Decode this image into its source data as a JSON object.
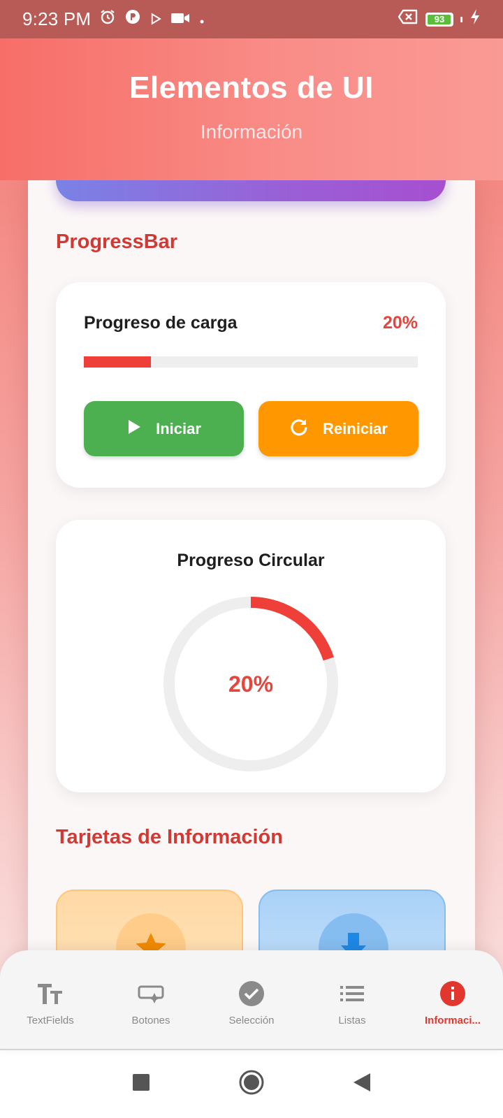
{
  "status_bar": {
    "time": "9:23 PM",
    "battery": "93",
    "icons_left": [
      "alarm-icon",
      "app-icon",
      "play-store-icon",
      "video-icon",
      "dot-icon"
    ],
    "icons_right": [
      "no-sim-icon",
      "battery-icon",
      "charging-icon"
    ]
  },
  "header": {
    "title": "Elementos de UI",
    "subtitle": "Información"
  },
  "progressbar_section": {
    "title": "ProgressBar",
    "label": "Progreso de carga",
    "percent_text": "20%",
    "progress": 0.2,
    "start_button": "Iniciar",
    "reset_button": "Reiniciar"
  },
  "circular_section": {
    "title": "Progreso Circular",
    "percent_text": "20%",
    "progress": 0.2
  },
  "info_cards_section": {
    "title": "Tarjetas de Información",
    "cards": [
      {
        "icon": "star-icon",
        "color": "#ff9800"
      },
      {
        "icon": "download-icon",
        "color": "#1e88e5"
      }
    ]
  },
  "bottom_nav": {
    "items": [
      {
        "label": "TextFields",
        "icon": "text-fields-icon",
        "active": false
      },
      {
        "label": "Botones",
        "icon": "buttons-icon",
        "active": false
      },
      {
        "label": "Selección",
        "icon": "check-circle-icon",
        "active": false
      },
      {
        "label": "Listas",
        "icon": "list-icon",
        "active": false
      },
      {
        "label": "Informaci...",
        "icon": "info-icon",
        "active": true
      }
    ]
  },
  "colors": {
    "accent": "#e2372f",
    "progress_fill": "#ef3f39",
    "start_button": "#4caf50",
    "reset_button": "#ff9800",
    "section_title": "#d03a35"
  }
}
